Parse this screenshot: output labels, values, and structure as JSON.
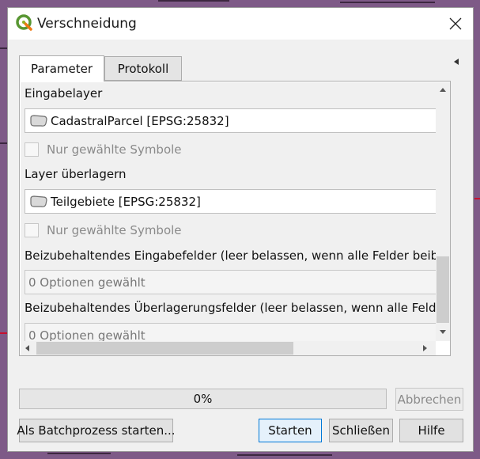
{
  "window": {
    "title": "Verschneidung",
    "icon": "qgis-logo-icon",
    "close_icon": "close-icon"
  },
  "tabs": [
    {
      "label": "Parameter",
      "active": true
    },
    {
      "label": "Protokoll",
      "active": false
    }
  ],
  "parameters": {
    "input_layer_label": "Eingabelayer",
    "input_layer_value": "CadastralParcel [EPSG:25832]",
    "input_selected_only_label": "Nur gewählte Symbole",
    "overlay_layer_label": "Layer überlagern",
    "overlay_layer_value": "Teilgebiete [EPSG:25832]",
    "overlay_selected_only_label": "Nur gewählte Symbole",
    "input_fields_label": "Beizubehaltendes Eingabefelder (leer belassen, wenn alle Felder beibehalt",
    "input_fields_value": "0 Optionen gewählt",
    "overlay_fields_label": "Beizubehaltendes Überlagerungsfelder (leer belassen, wenn alle Felder be",
    "overlay_fields_value": "0 Optionen gewählt"
  },
  "progress": {
    "text": "0%",
    "value": 0
  },
  "buttons": {
    "cancel": "Abbrechen",
    "batch": "Als Batchprozess starten...",
    "run": "Starten",
    "close": "Schließen",
    "help": "Hilfe"
  },
  "colors": {
    "map_background": "#7e5a87",
    "default_button_border": "#0078d7"
  }
}
